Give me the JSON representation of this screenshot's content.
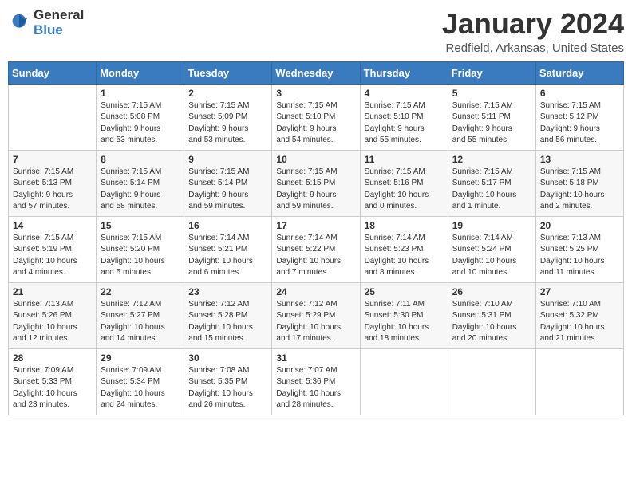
{
  "logo": {
    "text_general": "General",
    "text_blue": "Blue"
  },
  "header": {
    "month": "January 2024",
    "location": "Redfield, Arkansas, United States"
  },
  "weekdays": [
    "Sunday",
    "Monday",
    "Tuesday",
    "Wednesday",
    "Thursday",
    "Friday",
    "Saturday"
  ],
  "weeks": [
    [
      {
        "day": "",
        "info": ""
      },
      {
        "day": "1",
        "info": "Sunrise: 7:15 AM\nSunset: 5:08 PM\nDaylight: 9 hours\nand 53 minutes."
      },
      {
        "day": "2",
        "info": "Sunrise: 7:15 AM\nSunset: 5:09 PM\nDaylight: 9 hours\nand 53 minutes."
      },
      {
        "day": "3",
        "info": "Sunrise: 7:15 AM\nSunset: 5:10 PM\nDaylight: 9 hours\nand 54 minutes."
      },
      {
        "day": "4",
        "info": "Sunrise: 7:15 AM\nSunset: 5:10 PM\nDaylight: 9 hours\nand 55 minutes."
      },
      {
        "day": "5",
        "info": "Sunrise: 7:15 AM\nSunset: 5:11 PM\nDaylight: 9 hours\nand 55 minutes."
      },
      {
        "day": "6",
        "info": "Sunrise: 7:15 AM\nSunset: 5:12 PM\nDaylight: 9 hours\nand 56 minutes."
      }
    ],
    [
      {
        "day": "7",
        "info": "Sunrise: 7:15 AM\nSunset: 5:13 PM\nDaylight: 9 hours\nand 57 minutes."
      },
      {
        "day": "8",
        "info": "Sunrise: 7:15 AM\nSunset: 5:14 PM\nDaylight: 9 hours\nand 58 minutes."
      },
      {
        "day": "9",
        "info": "Sunrise: 7:15 AM\nSunset: 5:14 PM\nDaylight: 9 hours\nand 59 minutes."
      },
      {
        "day": "10",
        "info": "Sunrise: 7:15 AM\nSunset: 5:15 PM\nDaylight: 9 hours\nand 59 minutes."
      },
      {
        "day": "11",
        "info": "Sunrise: 7:15 AM\nSunset: 5:16 PM\nDaylight: 10 hours\nand 0 minutes."
      },
      {
        "day": "12",
        "info": "Sunrise: 7:15 AM\nSunset: 5:17 PM\nDaylight: 10 hours\nand 1 minute."
      },
      {
        "day": "13",
        "info": "Sunrise: 7:15 AM\nSunset: 5:18 PM\nDaylight: 10 hours\nand 2 minutes."
      }
    ],
    [
      {
        "day": "14",
        "info": "Sunrise: 7:15 AM\nSunset: 5:19 PM\nDaylight: 10 hours\nand 4 minutes."
      },
      {
        "day": "15",
        "info": "Sunrise: 7:15 AM\nSunset: 5:20 PM\nDaylight: 10 hours\nand 5 minutes."
      },
      {
        "day": "16",
        "info": "Sunrise: 7:14 AM\nSunset: 5:21 PM\nDaylight: 10 hours\nand 6 minutes."
      },
      {
        "day": "17",
        "info": "Sunrise: 7:14 AM\nSunset: 5:22 PM\nDaylight: 10 hours\nand 7 minutes."
      },
      {
        "day": "18",
        "info": "Sunrise: 7:14 AM\nSunset: 5:23 PM\nDaylight: 10 hours\nand 8 minutes."
      },
      {
        "day": "19",
        "info": "Sunrise: 7:14 AM\nSunset: 5:24 PM\nDaylight: 10 hours\nand 10 minutes."
      },
      {
        "day": "20",
        "info": "Sunrise: 7:13 AM\nSunset: 5:25 PM\nDaylight: 10 hours\nand 11 minutes."
      }
    ],
    [
      {
        "day": "21",
        "info": "Sunrise: 7:13 AM\nSunset: 5:26 PM\nDaylight: 10 hours\nand 12 minutes."
      },
      {
        "day": "22",
        "info": "Sunrise: 7:12 AM\nSunset: 5:27 PM\nDaylight: 10 hours\nand 14 minutes."
      },
      {
        "day": "23",
        "info": "Sunrise: 7:12 AM\nSunset: 5:28 PM\nDaylight: 10 hours\nand 15 minutes."
      },
      {
        "day": "24",
        "info": "Sunrise: 7:12 AM\nSunset: 5:29 PM\nDaylight: 10 hours\nand 17 minutes."
      },
      {
        "day": "25",
        "info": "Sunrise: 7:11 AM\nSunset: 5:30 PM\nDaylight: 10 hours\nand 18 minutes."
      },
      {
        "day": "26",
        "info": "Sunrise: 7:10 AM\nSunset: 5:31 PM\nDaylight: 10 hours\nand 20 minutes."
      },
      {
        "day": "27",
        "info": "Sunrise: 7:10 AM\nSunset: 5:32 PM\nDaylight: 10 hours\nand 21 minutes."
      }
    ],
    [
      {
        "day": "28",
        "info": "Sunrise: 7:09 AM\nSunset: 5:33 PM\nDaylight: 10 hours\nand 23 minutes."
      },
      {
        "day": "29",
        "info": "Sunrise: 7:09 AM\nSunset: 5:34 PM\nDaylight: 10 hours\nand 24 minutes."
      },
      {
        "day": "30",
        "info": "Sunrise: 7:08 AM\nSunset: 5:35 PM\nDaylight: 10 hours\nand 26 minutes."
      },
      {
        "day": "31",
        "info": "Sunrise: 7:07 AM\nSunset: 5:36 PM\nDaylight: 10 hours\nand 28 minutes."
      },
      {
        "day": "",
        "info": ""
      },
      {
        "day": "",
        "info": ""
      },
      {
        "day": "",
        "info": ""
      }
    ]
  ]
}
